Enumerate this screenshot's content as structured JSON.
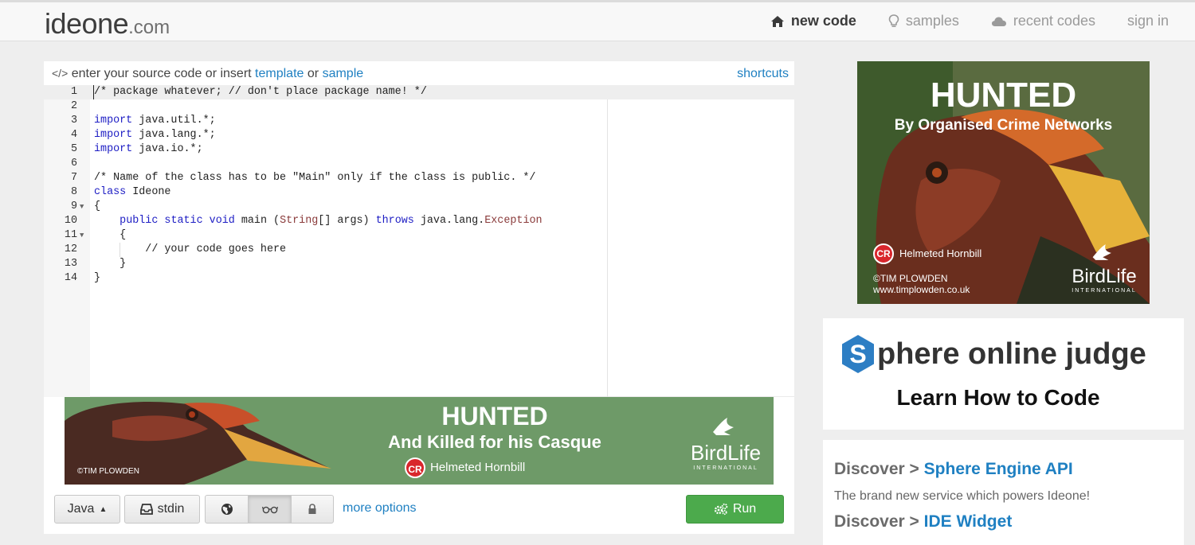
{
  "header": {
    "logo_main": "ideone",
    "logo_tld": ".com",
    "nav": [
      {
        "label": "new code",
        "icon": "home-icon",
        "active": true
      },
      {
        "label": "samples",
        "icon": "lightbulb-icon",
        "active": false
      },
      {
        "label": "recent codes",
        "icon": "cloud-icon",
        "active": false
      },
      {
        "label": "sign in",
        "icon": "",
        "active": false
      }
    ]
  },
  "editor": {
    "header_prefix": "enter your source code or insert",
    "template_link": "template",
    "or_text": "or",
    "sample_link": "sample",
    "shortcuts_link": "shortcuts",
    "lines": [
      "/* package whatever; // don't place package name! */",
      "",
      "import java.util.*;",
      "import java.lang.*;",
      "import java.io.*;",
      "",
      "/* Name of the class has to be \"Main\" only if the class is public. */",
      "class Ideone",
      "{",
      "    public static void main (String[] args) throws java.lang.Exception",
      "    {",
      "        // your code goes here",
      "    }",
      "}"
    ]
  },
  "banner": {
    "title": "HUNTED",
    "subtitle": "And Killed for his Casque",
    "cr_badge": "CR",
    "species": "Helmeted Hornbill",
    "credit": "©TIM PLOWDEN",
    "org": "BirdLife",
    "org_sub": "INTERNATIONAL"
  },
  "toolbar": {
    "language": "Java",
    "stdin": "stdin",
    "more_options": "more options",
    "run": "Run"
  },
  "ad_right": {
    "title": "HUNTED",
    "subtitle": "By Organised Crime Networks",
    "cr_badge": "CR",
    "species": "Helmeted Hornbill",
    "credit_line1": "©TIM PLOWDEN",
    "credit_line2": "www.timplowden.co.uk",
    "org": "BirdLife",
    "org_sub": "INTERNATIONAL"
  },
  "spoj": {
    "logo_letter": "S",
    "name": "phere online judge",
    "tagline": "Learn How to Code"
  },
  "discover": {
    "prefix": "Discover >",
    "item1_link": "Sphere Engine API",
    "item1_desc": "The brand new service which powers Ideone!",
    "item2_link": "IDE Widget"
  },
  "colors": {
    "link": "#1f80c2",
    "run": "#4caa4c",
    "banner_green": "#6e9a68",
    "cr_red": "#d9262c"
  }
}
